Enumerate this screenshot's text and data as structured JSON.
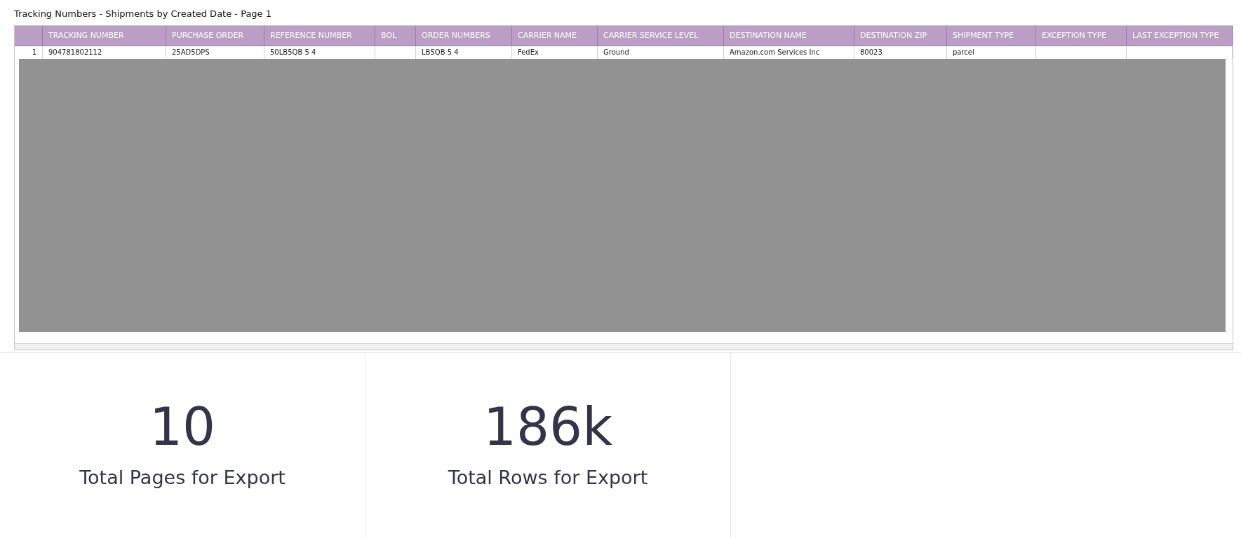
{
  "title": "Tracking Numbers - Shipments by Created Date - Page 1",
  "table": {
    "columns": [
      "TRACKING NUMBER",
      "PURCHASE ORDER",
      "REFERENCE NUMBER",
      "BOL",
      "ORDER NUMBERS",
      "CARRIER NAME",
      "CARRIER SERVICE LEVEL",
      "DESTINATION NAME",
      "DESTINATION ZIP",
      "SHIPMENT TYPE",
      "EXCEPTION TYPE",
      "LAST EXCEPTION TYPE"
    ],
    "rows": [
      {
        "index": "1",
        "cells": [
          "904781802112",
          "25AD5DPS",
          "50LB5QB 5 4",
          "",
          "LB5QB 5 4",
          "FedEx",
          "Ground",
          "Amazon.com Services Inc",
          "80023",
          "parcel",
          "",
          ""
        ]
      }
    ]
  },
  "cards": [
    {
      "value": "10",
      "label": "Total Pages for Export"
    },
    {
      "value": "186k",
      "label": "Total Rows for Export"
    }
  ]
}
